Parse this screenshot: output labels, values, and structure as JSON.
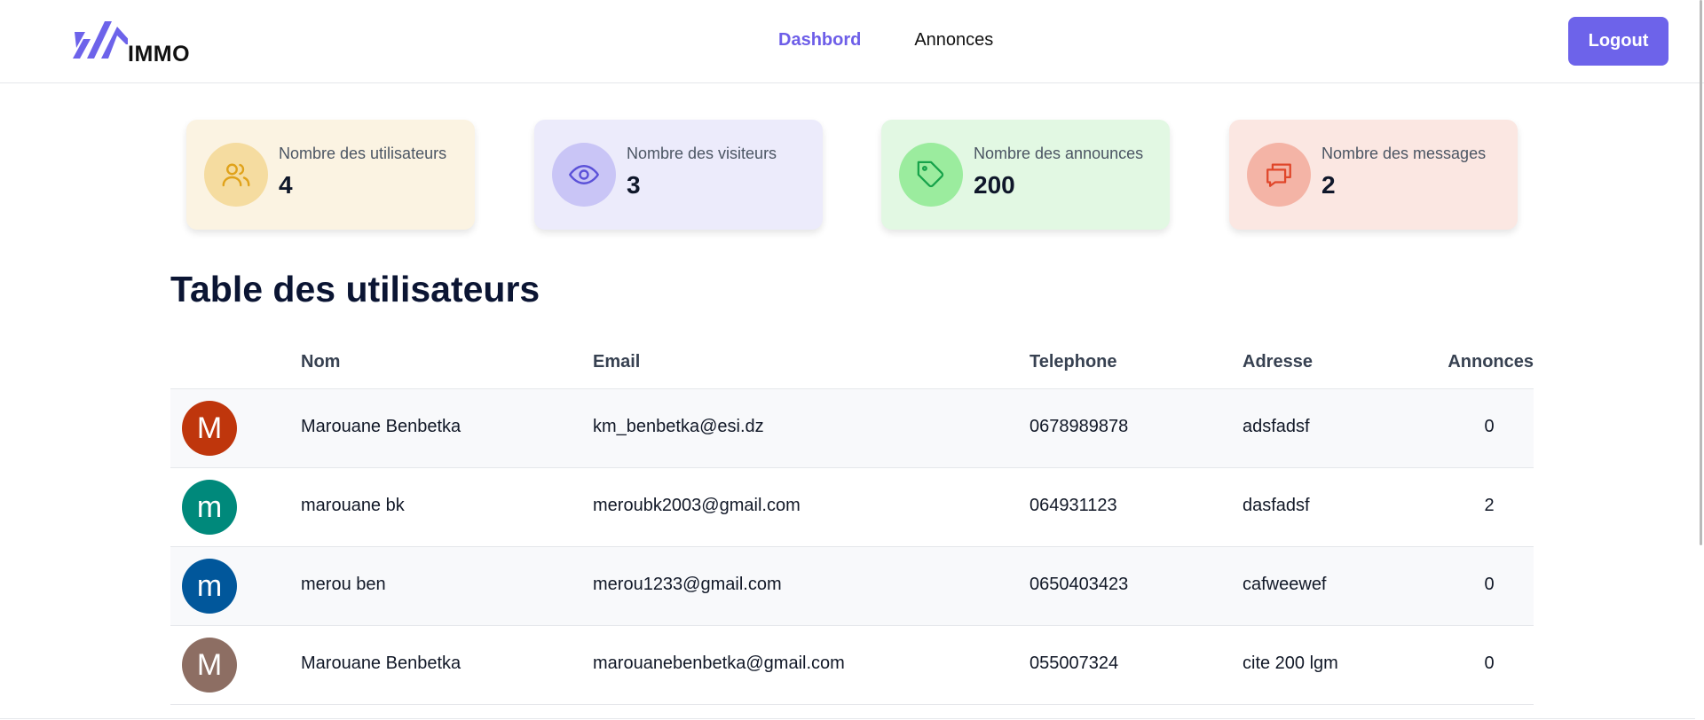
{
  "brand": {
    "name": "IMMO",
    "accent": "#6d63ea"
  },
  "nav": {
    "items": [
      {
        "label": "Dashbord",
        "active": true
      },
      {
        "label": "Annonces",
        "active": false
      }
    ]
  },
  "header": {
    "logout_label": "Logout"
  },
  "stats": [
    {
      "label": "Nombre des utilisateurs",
      "value": "4",
      "icon": "users-icon",
      "bg": "#fbf3e2",
      "circle": "#f5dca0",
      "icon_color": "#e0a21a"
    },
    {
      "label": "Nombre des visiteurs",
      "value": "3",
      "icon": "eye-icon",
      "bg": "#ecebfb",
      "circle": "#c9c5f6",
      "icon_color": "#5b51d8"
    },
    {
      "label": "Nombre des announces",
      "value": "200",
      "icon": "tag-icon",
      "bg": "#e2f8e3",
      "circle": "#9bec9e",
      "icon_color": "#16a34a"
    },
    {
      "label": "Nombre des messages",
      "value": "2",
      "icon": "chat-icon",
      "bg": "#fbe7e2",
      "circle": "#f4b4a6",
      "icon_color": "#e0462a"
    }
  ],
  "table": {
    "title": "Table des utilisateurs",
    "columns": [
      "Nom",
      "Email",
      "Telephone",
      "Adresse",
      "Annonces"
    ],
    "rows": [
      {
        "initial": "M",
        "avatar_color": "#bf360c",
        "nom": "Marouane Benbetka",
        "email": "km_benbetka@esi.dz",
        "telephone": "0678989878",
        "adresse": "adsfadsf",
        "annonces": "0"
      },
      {
        "initial": "m",
        "avatar_color": "#00897b",
        "nom": "marouane bk",
        "email": "meroubk2003@gmail.com",
        "telephone": "064931123",
        "adresse": "dasfadsf",
        "annonces": "2"
      },
      {
        "initial": "m",
        "avatar_color": "#01579b",
        "nom": "merou ben",
        "email": "merou1233@gmail.com",
        "telephone": "0650403423",
        "adresse": "cafweewef",
        "annonces": "0"
      },
      {
        "initial": "M",
        "avatar_color": "#8d6e63",
        "nom": "Marouane Benbetka",
        "email": "marouanebenbetka@gmail.com",
        "telephone": "055007324",
        "adresse": "cite 200 lgm",
        "annonces": "0"
      }
    ]
  }
}
